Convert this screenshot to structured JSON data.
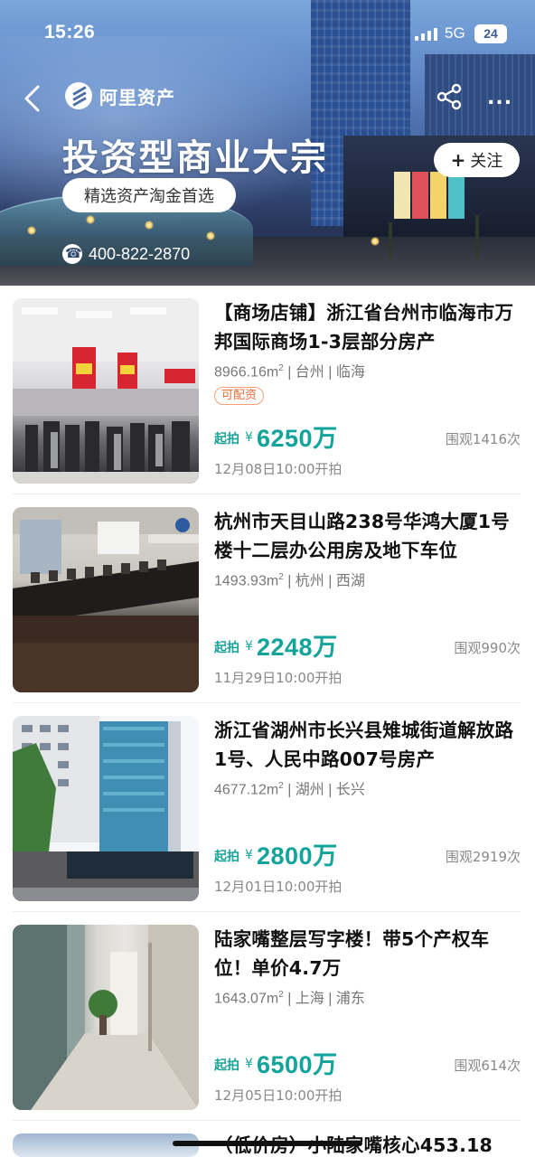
{
  "status_bar": {
    "time": "15:26",
    "network": "5G",
    "battery": "24"
  },
  "header": {
    "brand_name": "阿里资产",
    "title": "投资型商业大宗",
    "slogan": "精选资产淘金首选",
    "hotline": "400-822-2870",
    "follow_label": "关注",
    "more_label": "..."
  },
  "listings": [
    {
      "title": "【商场店铺】浙江省台州市临海市万邦国际商场1-3层部分房产",
      "area": "8966.16m",
      "city": "台州",
      "district": "临海",
      "tag": "可配资",
      "price_prefix": "起拍",
      "currency": "¥",
      "price": "6250万",
      "views": "围观1416次",
      "date": "12月08日10:00开拍",
      "image": "store-interior"
    },
    {
      "title": "杭州市天目山路238号华鸿大厦1号楼十二层办公用房及地下车位",
      "area": "1493.93m",
      "city": "杭州",
      "district": "西湖",
      "tag": "",
      "price_prefix": "起拍",
      "currency": "¥",
      "price": "2248万",
      "views": "围观990次",
      "date": "11月29日10:00开拍",
      "image": "conference-room"
    },
    {
      "title": "浙江省湖州市长兴县雉城街道解放路1号、人民中路007号房产",
      "area": "4677.12m",
      "city": "湖州",
      "district": "长兴",
      "tag": "",
      "price_prefix": "起拍",
      "currency": "¥",
      "price": "2800万",
      "views": "围观2919次",
      "date": "12月01日10:00开拍",
      "image": "office-building"
    },
    {
      "title": "陆家嘴整层写字楼！带5个产权车位！单价4.7万",
      "area": "1643.07m",
      "city": "上海",
      "district": "浦东",
      "tag": "",
      "price_prefix": "起拍",
      "currency": "¥",
      "price": "6500万",
      "views": "围观614次",
      "date": "12月05日10:00开拍",
      "image": "office-corridor"
    }
  ],
  "partial_listing": {
    "title": "（低价房）小陆家嘴核心453.18"
  },
  "colors": {
    "price": "#12a39a",
    "tag": "#ef6a3a"
  }
}
